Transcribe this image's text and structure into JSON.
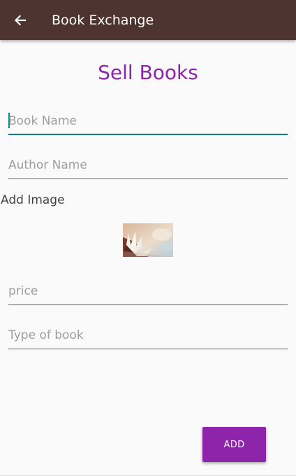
{
  "appbar": {
    "back_icon": "arrow-left-icon",
    "title": "Book Exchange"
  },
  "page": {
    "heading": "Sell Books"
  },
  "form": {
    "book_name_placeholder": "Book Name",
    "author_name_placeholder": "Author Name",
    "add_image_label": "Add Image",
    "image_icon": "open-book-image",
    "price_placeholder": "price",
    "type_placeholder": "Type of book",
    "add_button_label": "ADD"
  },
  "colors": {
    "appbar": "#4e342e",
    "accent": "#8e24aa",
    "focus": "#00897b"
  }
}
